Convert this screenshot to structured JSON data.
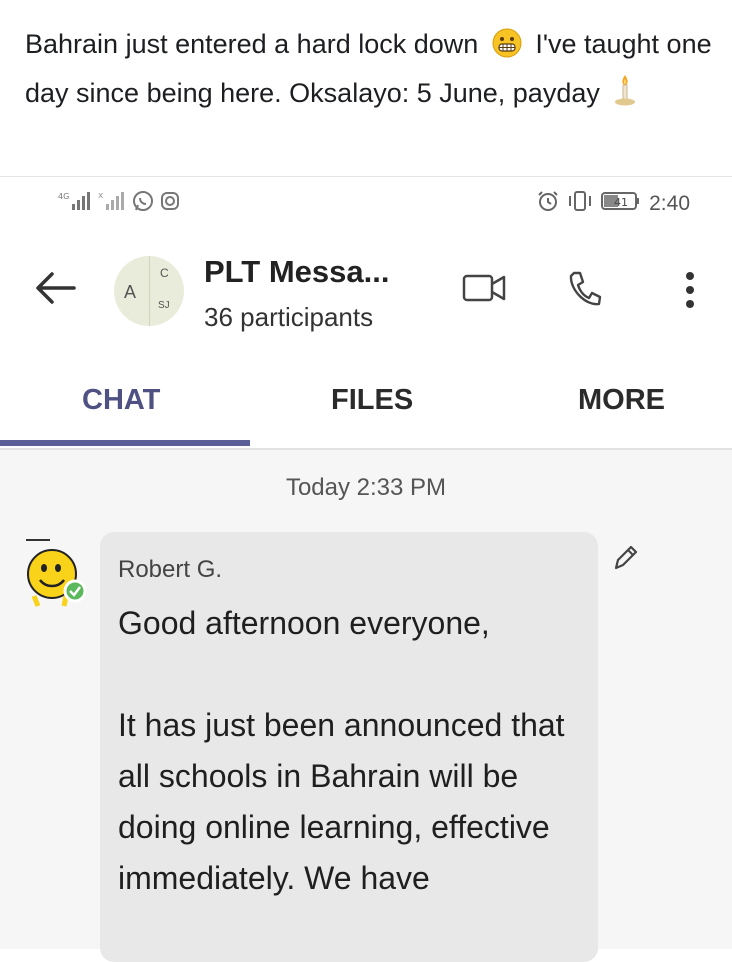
{
  "post": {
    "caption_part1": "Bahrain just entered a hard lock down",
    "caption_part2": "I've taught one day since being here. Oksalayo: 5 June, payday",
    "emoji1_icon": "grimacing-face-emoji",
    "emoji2_icon": "candle-emoji"
  },
  "status_bar": {
    "time": "2:40",
    "battery": "41",
    "left_icons": [
      "4g-signal-icon",
      "signal-icon",
      "whatsapp-icon",
      "instagram-icon"
    ],
    "right_icons": [
      "alarm-icon",
      "vibrate-icon",
      "battery-icon"
    ]
  },
  "header": {
    "title": "PLT Messa...",
    "subtitle": "36 participants",
    "avatar_letters": {
      "a": "A",
      "c": "C",
      "sj": "SJ"
    }
  },
  "tabs": [
    {
      "label": "CHAT",
      "active": true
    },
    {
      "label": "FILES",
      "active": false
    },
    {
      "label": "MORE",
      "active": false
    }
  ],
  "conversation": {
    "date_separator": "Today 2:33 PM",
    "message": {
      "sender": "Robert G.",
      "text": "Good afternoon everyone,\n\nIt has just been announced that all schools in Bahrain will be doing online learning, effective immediately. We have"
    }
  },
  "colors": {
    "accent": "#5b5f97",
    "active_tab_text": "#4e5182",
    "bubble_bg": "#e8e8e8",
    "conversation_bg": "#f6f6f6",
    "presence_green": "#5cb85c"
  }
}
